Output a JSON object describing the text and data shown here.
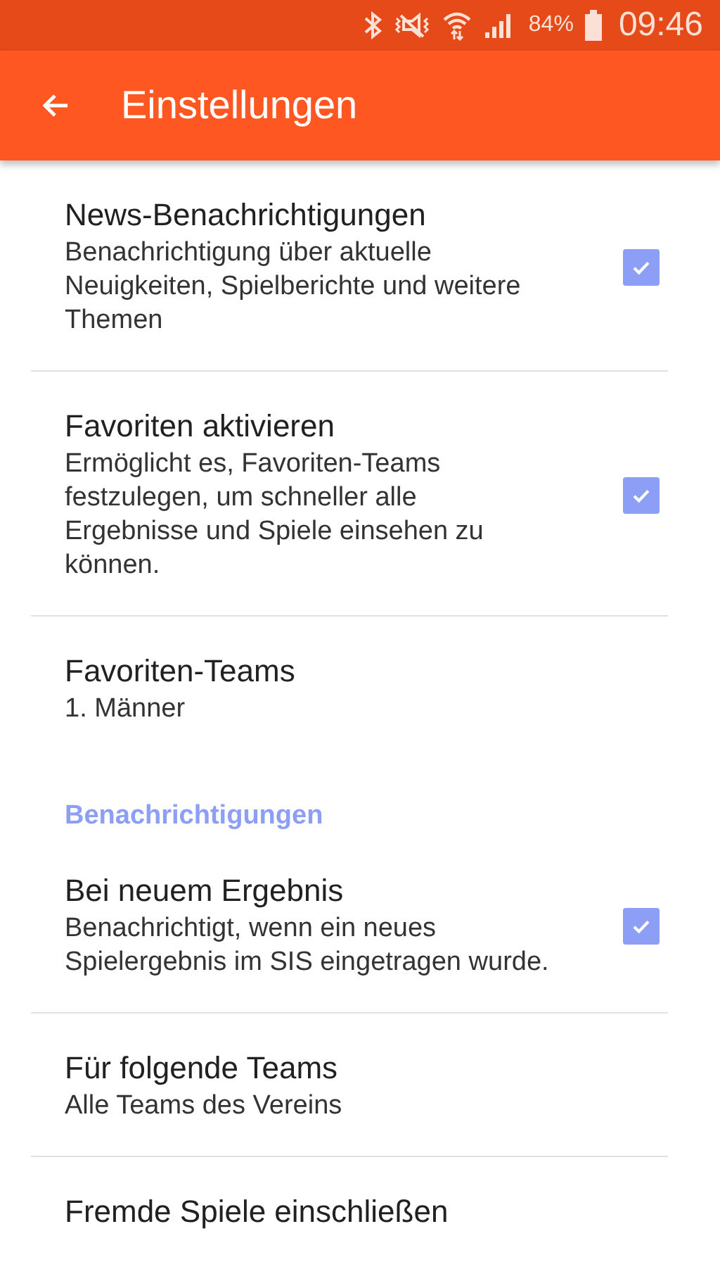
{
  "status_bar": {
    "battery_percent": "84%",
    "time": "09:46"
  },
  "toolbar": {
    "title": "Einstellungen"
  },
  "items": [
    {
      "kind": "check",
      "title": "News-Benachrichtigungen",
      "summary": "Benachrichtigung über aktuelle Neuigkeiten, Spielberichte und weitere Themen",
      "checked": true,
      "divider": true
    },
    {
      "kind": "check",
      "title": "Favoriten aktivieren",
      "summary": "Ermöglicht es, Favoriten-Teams festzulegen, um schneller alle Ergebnisse und Spiele einsehen zu können.",
      "checked": true,
      "divider": true
    },
    {
      "kind": "value",
      "title": "Favoriten-Teams",
      "summary": "1. Männer",
      "divider": false
    },
    {
      "kind": "header",
      "title": "Benachrichtigungen"
    },
    {
      "kind": "check",
      "title": "Bei neuem Ergebnis",
      "summary": "Benachrichtigt, wenn ein neues Spielergebnis im SIS eingetragen wurde.",
      "checked": true,
      "divider": true
    },
    {
      "kind": "value",
      "title": "Für folgende Teams",
      "summary": "Alle Teams des Vereins",
      "divider": true
    },
    {
      "kind": "value",
      "title": "Fremde Spiele einschließen",
      "divider": false
    }
  ]
}
